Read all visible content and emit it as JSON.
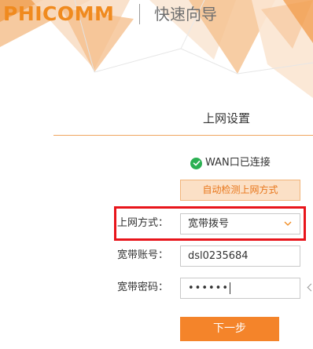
{
  "header": {
    "logo_text": "PHICOMM",
    "title": "快速向导"
  },
  "section": {
    "title": "上网设置"
  },
  "status": {
    "icon": "check-circle-icon",
    "text": "WAN口已连接"
  },
  "detect_button": {
    "label": "自动检测上网方式"
  },
  "form": {
    "connection_type": {
      "label": "上网方式：",
      "value": "宽带拨号"
    },
    "account": {
      "label": "宽带账号：",
      "value": "dsl0235684"
    },
    "password": {
      "label": "宽带密码：",
      "value": "••••••"
    }
  },
  "next_button": {
    "label": "下一步"
  },
  "colors": {
    "brand": "#f08a1e",
    "accent": "#f4842a",
    "highlight": "#e8151b",
    "success": "#2bb052"
  }
}
